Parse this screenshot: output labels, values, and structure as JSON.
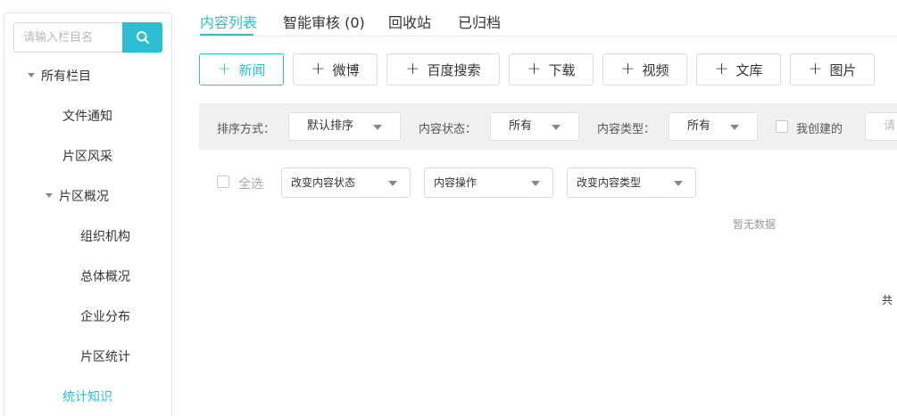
{
  "sidebar": {
    "search_placeholder": "请输入栏目名",
    "items": [
      {
        "label": "所有栏目"
      },
      {
        "label": "文件通知"
      },
      {
        "label": "片区风采"
      },
      {
        "label": "片区概况"
      },
      {
        "label": "组织机构"
      },
      {
        "label": "总体概况"
      },
      {
        "label": "企业分布"
      },
      {
        "label": "片区统计"
      },
      {
        "label": "统计知识"
      }
    ]
  },
  "tabs": [
    {
      "label": "内容列表",
      "active": true
    },
    {
      "label": "智能审核 (0)"
    },
    {
      "label": "回收站"
    },
    {
      "label": "已归档"
    }
  ],
  "add_buttons": [
    {
      "label": "新闻"
    },
    {
      "label": "微博"
    },
    {
      "label": "百度搜索"
    },
    {
      "label": "下载"
    },
    {
      "label": "视频"
    },
    {
      "label": "文库"
    },
    {
      "label": "图片"
    }
  ],
  "filters": {
    "sort_label": "排序方式：",
    "sort_value": "默认排序",
    "status_label": "内容状态：",
    "status_value": "所有",
    "type_label": "内容类型：",
    "type_value": "所有",
    "mine_label": "我创建的",
    "search_placeholder_partial": "请"
  },
  "actions": {
    "select_all_label": "全选",
    "change_status": "改变内容状态",
    "content_ops": "内容操作",
    "change_type": "改变内容类型"
  },
  "empty_text": "暂无数据",
  "pagination_total_partial": "共",
  "colors": {
    "accent": "#2cbfd3",
    "filter_bg": "#f0f0f0"
  }
}
